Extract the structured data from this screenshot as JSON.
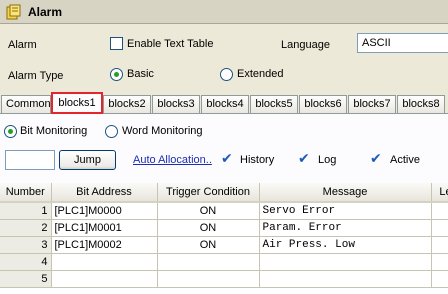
{
  "window": {
    "title": "Alarm",
    "icon": "alarm-app-icon"
  },
  "settings": {
    "alarm_label": "Alarm",
    "enable_text_table_label": "Enable Text Table",
    "enable_text_table_checked": false,
    "language_label": "Language",
    "language_value": "ASCII",
    "alarm_type_label": "Alarm Type",
    "alarm_type_options": [
      "Basic",
      "Extended"
    ],
    "alarm_type_selected": "Basic"
  },
  "tabs": [
    "Common",
    "blocks1",
    "blocks2",
    "blocks3",
    "blocks4",
    "blocks5",
    "blocks6",
    "blocks7",
    "blocks8"
  ],
  "active_tab": "blocks1",
  "monitoring": {
    "options": [
      "Bit Monitoring",
      "Word Monitoring"
    ],
    "selected": "Bit Monitoring"
  },
  "toolbar": {
    "jump_value": "",
    "jump_label": "Jump",
    "auto_allocation_label": "Auto Allocation..",
    "history_label": "History",
    "log_label": "Log",
    "active_label": "Active",
    "history_checked": true,
    "log_checked": true,
    "active_checked": true
  },
  "table": {
    "columns": [
      "Number",
      "Bit Address",
      "Trigger Condition",
      "Message",
      "Le"
    ],
    "rows": [
      [
        "1",
        "[PLC1]M0000",
        "ON",
        "Servo Error",
        ""
      ],
      [
        "2",
        "[PLC1]M0001",
        "ON",
        "Param. Error",
        ""
      ],
      [
        "3",
        "[PLC1]M0002",
        "ON",
        "Air Press. Low",
        ""
      ],
      [
        "4",
        "",
        "",
        "",
        ""
      ],
      [
        "5",
        "",
        "",
        "",
        ""
      ]
    ]
  },
  "colors": {
    "active_tab_border": "#e2262b",
    "link": "#1b2db4",
    "check": "#1c5bb8"
  }
}
